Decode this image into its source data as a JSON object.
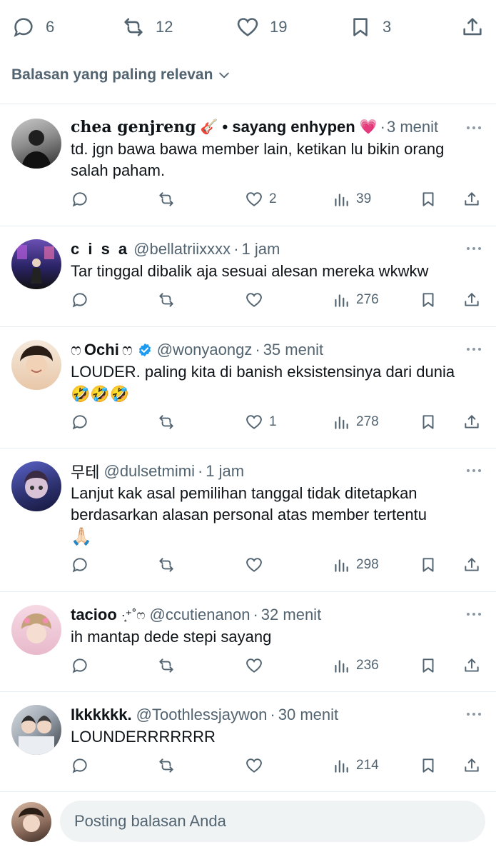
{
  "top_actions": {
    "replies": "6",
    "reposts": "12",
    "likes": "19",
    "bookmarks": "3"
  },
  "sort": {
    "label": "Balasan yang paling relevan"
  },
  "replies": [
    {
      "name_part1": "chea genjreng",
      "name_emoji1": "🎸",
      "name_part2": "• sayang enhypen",
      "name_emoji2": "💗",
      "handle": "",
      "time": "3 menit",
      "text": "td. jgn bawa bawa member lain, ketikan lu bikin orang salah paham.",
      "like_count": "2",
      "views": "39"
    },
    {
      "name": "c i s a",
      "handle": "@bellatriixxxx",
      "time": "1 jam",
      "text": "Tar tinggal dibalik aja sesuai alesan mereka wkwkw",
      "like_count": "",
      "views": "276"
    },
    {
      "name_prefix": "ෆ",
      "name": "Ochi",
      "name_suffix": "ෆ",
      "handle": "@wonyaongz",
      "time": "35 menit",
      "text": "LOUDER. paling kita di banish eksistensinya dari dunia",
      "text_emoji": "🤣🤣🤣",
      "like_count": "1",
      "views": "278"
    },
    {
      "name": "무테",
      "handle": "@dulsetmimi",
      "time": "1 jam",
      "text": "Lanjut kak asal pemilihan tanggal tidak ditetapkan berdasarkan alasan personal atas member tertentu",
      "text_emoji": "🙏🏻",
      "like_count": "",
      "views": "298"
    },
    {
      "name": "tacioo",
      "name_suffix": "·͙⁺˚ෆ",
      "handle": "@ccutienanon",
      "time": "32 menit",
      "text": "ih mantap dede stepi sayang",
      "like_count": "",
      "views": "236"
    },
    {
      "name": "Ikkkkkk.",
      "handle": "@Toothlessjaywon",
      "time": "30 menit",
      "text": "LOUNDERRRRRRR",
      "like_count": "",
      "views": "214"
    }
  ],
  "compose": {
    "placeholder": "Posting balasan Anda"
  },
  "colors": {
    "secondary_text": "#536471",
    "verified": "#1d9bf0",
    "like_heart": "#f91880",
    "input_bg": "#eff3f4"
  }
}
